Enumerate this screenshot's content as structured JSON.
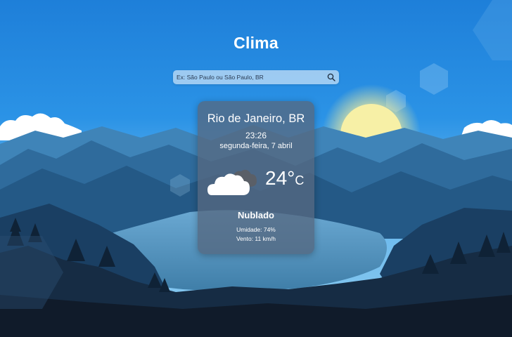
{
  "app": {
    "title": "Clima"
  },
  "search": {
    "placeholder": "Ex: São Paulo ou São Paulo, BR",
    "value": ""
  },
  "weather": {
    "city": "Rio de Janeiro, BR",
    "time": "23:26",
    "date": "segunda-feira, 7 abril",
    "temperature": "24°",
    "unit": "C",
    "description": "Nublado",
    "humidity": "Umidade: 74%",
    "wind": "Vento: 11 km/h",
    "icon": "cloudy-icon"
  }
}
